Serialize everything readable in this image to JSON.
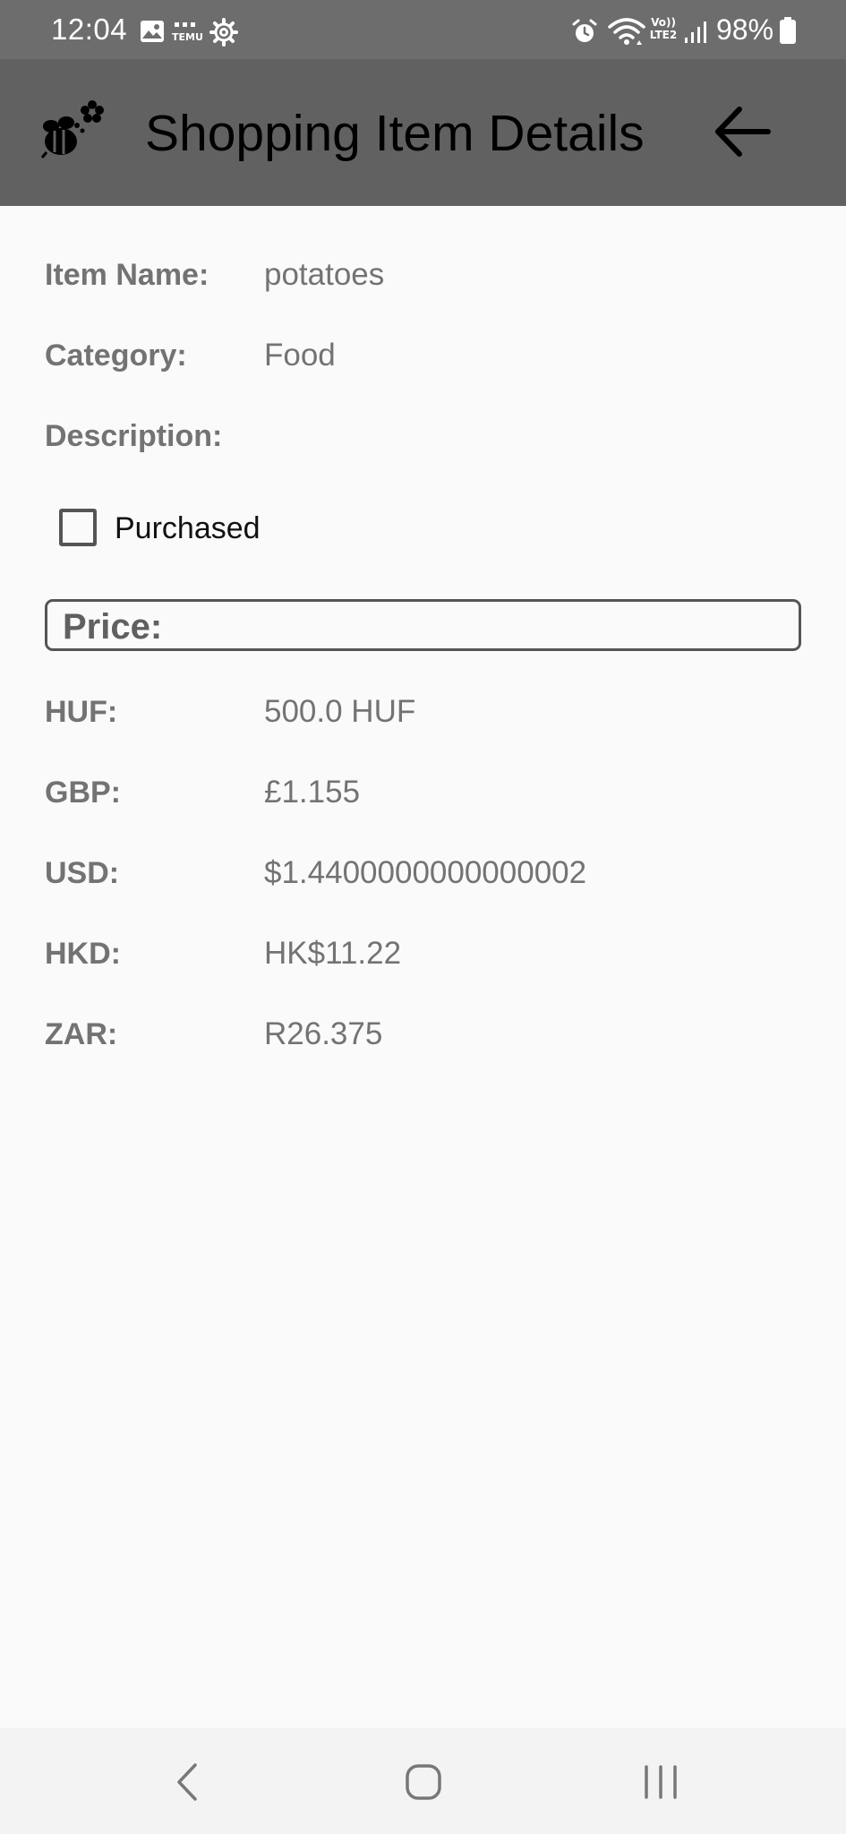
{
  "status_bar": {
    "time": "12:04",
    "battery_percent": "98%",
    "notification_icons": [
      "gallery-icon",
      "temu-icon",
      "settings-gear-icon"
    ],
    "system_icons": [
      "alarm-icon",
      "wifi-icon",
      "volte-lte2-icon",
      "signal-icon",
      "battery-icon"
    ],
    "volte_text": "Vo))",
    "lte_text": "LTE2"
  },
  "app_bar": {
    "title": "Shopping Item Details",
    "logo_icon": "bee-flower-logo-icon",
    "back_icon": "back-arrow-icon"
  },
  "item": {
    "name_label": "Item Name:",
    "name_value": "potatoes",
    "category_label": "Category:",
    "category_value": "Food",
    "description_label": "Description:",
    "description_value": "",
    "purchased_label": "Purchased",
    "purchased_checked": false
  },
  "price": {
    "title": "Price:",
    "rows": [
      {
        "currency": "HUF:",
        "value": "500.0 HUF"
      },
      {
        "currency": "GBP:",
        "value": "£1.155"
      },
      {
        "currency": "USD:",
        "value": "$1.4400000000000002"
      },
      {
        "currency": "HKD:",
        "value": "HK$11.22"
      },
      {
        "currency": "ZAR:",
        "value": "R26.375"
      }
    ]
  },
  "nav_bar": {
    "buttons": [
      "back-nav-icon",
      "home-nav-icon",
      "recents-nav-icon"
    ]
  },
  "colors": {
    "status_bar_bg": "#6d6d6d",
    "app_bar_bg": "#616161",
    "page_bg": "#fafafa",
    "label_text": "#737373",
    "nav_bar_bg": "#f3f3f3"
  }
}
